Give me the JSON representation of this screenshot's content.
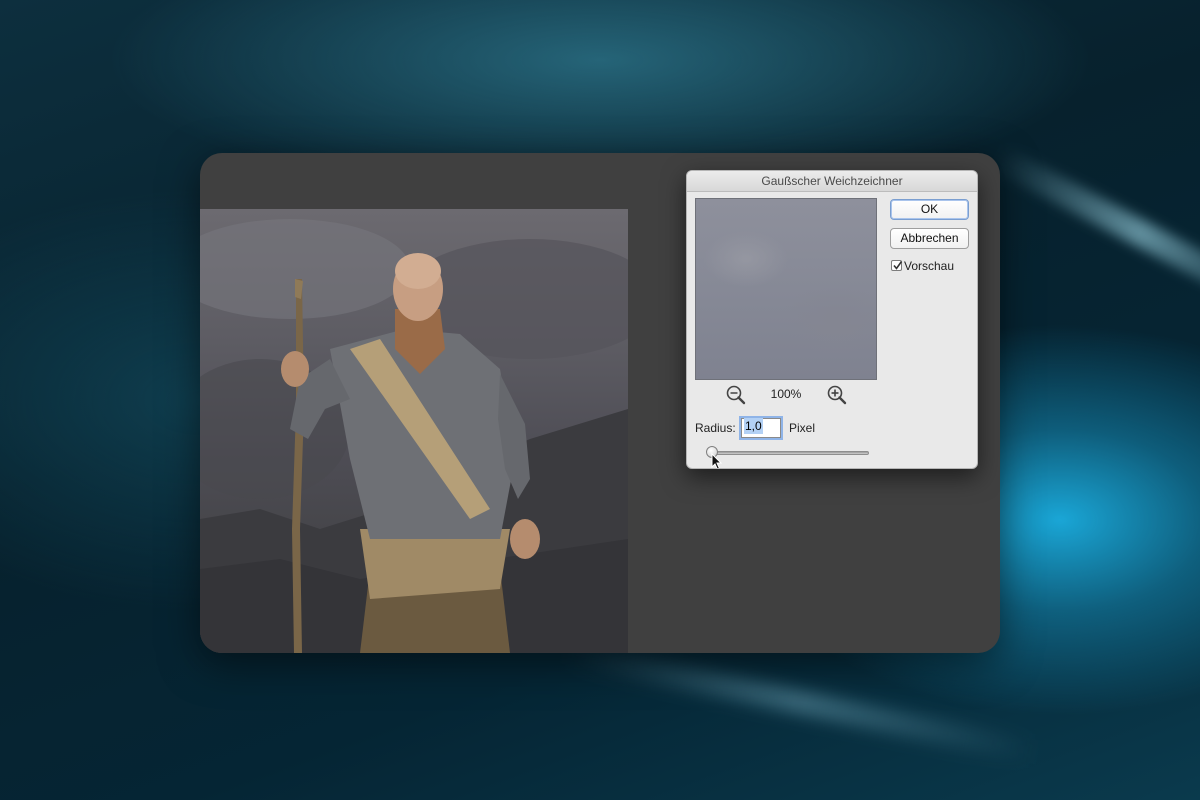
{
  "dialog": {
    "title": "Gaußscher Weichzeichner",
    "ok_label": "OK",
    "cancel_label": "Abbrechen",
    "preview_label": "Vorschau",
    "preview_checked": true,
    "zoom_level": "100%",
    "radius_label": "Radius:",
    "radius_value": "1,0",
    "radius_unit": "Pixel",
    "slider_position": 0.02
  },
  "colors": {
    "background_accent": "#1aa6d6",
    "window_bg": "#404040",
    "dialog_bg": "#e9e9e9",
    "selection": "#b3d1f5"
  },
  "icons": {
    "zoom_out": "zoom-out-icon",
    "zoom_in": "zoom-in-icon",
    "checkmark": "checkmark-icon",
    "cursor": "mouse-cursor-icon"
  }
}
